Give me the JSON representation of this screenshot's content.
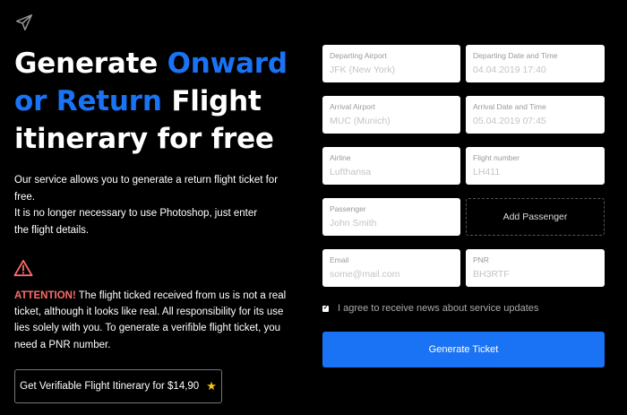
{
  "icons": {
    "logo": "airplane-icon",
    "warning": "warning-triangle-icon",
    "star": "star-icon",
    "checkbox": "checkmark-icon"
  },
  "colors": {
    "background": "#000000",
    "accent": "#1a73f5",
    "attention": "#ff6b6b",
    "star": "#f5c518"
  },
  "hero": {
    "title_part1": "Generate ",
    "title_accent": "Onward or Return",
    "title_part2": " Flight itinerary for free"
  },
  "description": {
    "line1": "Our service allows you to generate a return flight ticket for free.",
    "line2": "It is no longer necessary to use Photoshop, just enter",
    "line3": "the flight details."
  },
  "attention": {
    "label": "ATTENTION!",
    "text": " The flight ticked received from us is not a real ticket, although it looks like real. All responsibility for its use lies solely with you. To generate a verifible flight ticket, you need a PNR number."
  },
  "verify_button": {
    "label": "Get Verifiable Flight Itinerary for $14,90",
    "star": "★"
  },
  "form": {
    "departing_airport": {
      "label": "Departing Airport",
      "placeholder": "JFK (New York)"
    },
    "departing_datetime": {
      "label": "Departing Date and Time",
      "placeholder": "04.04.2019 17:40"
    },
    "arrival_airport": {
      "label": "Arrival Airport",
      "placeholder": "MUC (Munich)"
    },
    "arrival_datetime": {
      "label": "Arrival Date and Time",
      "placeholder": "05.04.2019 07:45"
    },
    "airline": {
      "label": "Airline",
      "placeholder": "Lufthansa"
    },
    "flight_number": {
      "label": "Flight number",
      "placeholder": "LH411"
    },
    "passenger": {
      "label": "Passenger",
      "placeholder": "John Smith"
    },
    "add_passenger": "Add Passenger",
    "email": {
      "label": "Email",
      "placeholder": "some@mail.com"
    },
    "pnr": {
      "label": "PNR",
      "placeholder": "BH3RTF"
    },
    "agree": {
      "checked": true,
      "text": "I agree to receive news about service updates"
    },
    "generate_button": "Generate Ticket"
  }
}
